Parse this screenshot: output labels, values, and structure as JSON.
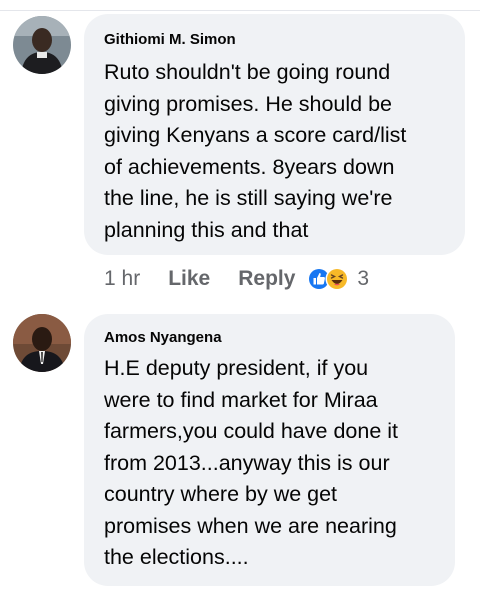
{
  "comments": [
    {
      "author": "Githiomi M. Simon",
      "lines": [
        "Ruto shouldn't be going round",
        "giving promises. He should be",
        "giving Kenyans a score card/list",
        "of achievements. 8years down",
        "the line, he is still saying we're",
        "planning this and that"
      ],
      "time": "1 hr",
      "like_label": "Like",
      "reply_label": "Reply",
      "reaction_count": "3",
      "reaction_icons": [
        "like-reaction-icon",
        "haha-reaction-icon"
      ]
    },
    {
      "author": "Amos Nyangena",
      "lines": [
        "H.E deputy president, if you",
        "were to find market for Miraa",
        "farmers,you could have done it",
        "from 2013...anyway this is our",
        "country where by we get",
        "promises when we are nearing",
        "the elections...."
      ]
    }
  ],
  "colors": {
    "bubble": "#f0f2f5",
    "text": "#050505",
    "meta": "#65676b",
    "like_blue": "#1877f2",
    "haha_yellow": "#f7b928"
  }
}
